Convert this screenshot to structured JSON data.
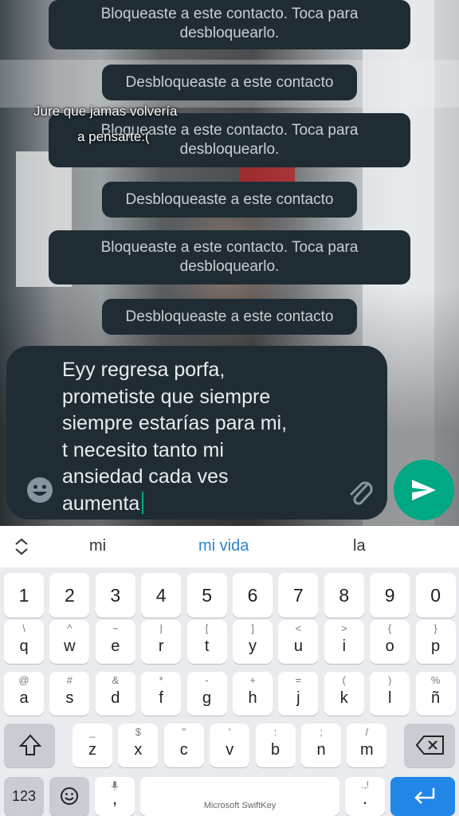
{
  "system_messages": [
    {
      "id": "blocked-1",
      "line1": "Bloqueaste a este contacto. Toca para",
      "line2": "desbloquearlo."
    },
    {
      "id": "unblocked-1",
      "text": "Desbloqueaste a este contacto"
    },
    {
      "id": "blocked-2",
      "line1": "Bloqueaste a este contacto. Toca para",
      "line2": "desbloquearlo."
    },
    {
      "id": "unblocked-2",
      "text": "Desbloqueaste a este contacto"
    },
    {
      "id": "blocked-3",
      "line1": "Bloqueaste a este contacto. Toca para",
      "line2": "desbloquearlo."
    },
    {
      "id": "unblocked-3",
      "text": "Desbloqueaste a este contacto"
    }
  ],
  "overlay_caption": {
    "line1": "Jure que jamas volvería",
    "line2": "a pensarte:("
  },
  "composer": {
    "text": "Eyy regresa porfa,\nprometiste que siempre\nsiempre estarías para mi,\nt necesito tanto mi\nansiedad cada ves\naumenta",
    "emoji_icon": "emoji-icon",
    "attach_icon": "paperclip-icon",
    "send_icon": "send-icon"
  },
  "suggestions": {
    "left": "mi",
    "middle": "mi vida",
    "right": "la"
  },
  "keyboard": {
    "numbers": [
      "1",
      "2",
      "3",
      "4",
      "5",
      "6",
      "7",
      "8",
      "9",
      "0"
    ],
    "row1": [
      [
        "q",
        "\\"
      ],
      [
        "w",
        "^"
      ],
      [
        "e",
        "~"
      ],
      [
        "r",
        "|"
      ],
      [
        "t",
        "["
      ],
      [
        "y",
        "]"
      ],
      [
        "u",
        "<"
      ],
      [
        "i",
        ">"
      ],
      [
        "o",
        "{"
      ],
      [
        "p",
        "}"
      ]
    ],
    "row2": [
      [
        "a",
        "@"
      ],
      [
        "s",
        "#"
      ],
      [
        "d",
        "&"
      ],
      [
        "f",
        "*"
      ],
      [
        "g",
        "-"
      ],
      [
        "h",
        "+"
      ],
      [
        "j",
        "="
      ],
      [
        "k",
        "("
      ],
      [
        "l",
        ")"
      ],
      [
        "ñ",
        "%"
      ]
    ],
    "row3": [
      [
        "z",
        "_"
      ],
      [
        "x",
        "$"
      ],
      [
        "c",
        "\""
      ],
      [
        "v",
        "'"
      ],
      [
        "b",
        ":"
      ],
      [
        "n",
        ";"
      ],
      [
        "m",
        "/"
      ]
    ],
    "symbols_label": "123",
    "space_label": "Microsoft SwiftKey",
    "comma": ",",
    "period": "."
  },
  "colors": {
    "accent": "#00a884",
    "bubble": "#1f2c33",
    "keyboard_bg": "#e9ebef",
    "enter": "#2186e8"
  }
}
